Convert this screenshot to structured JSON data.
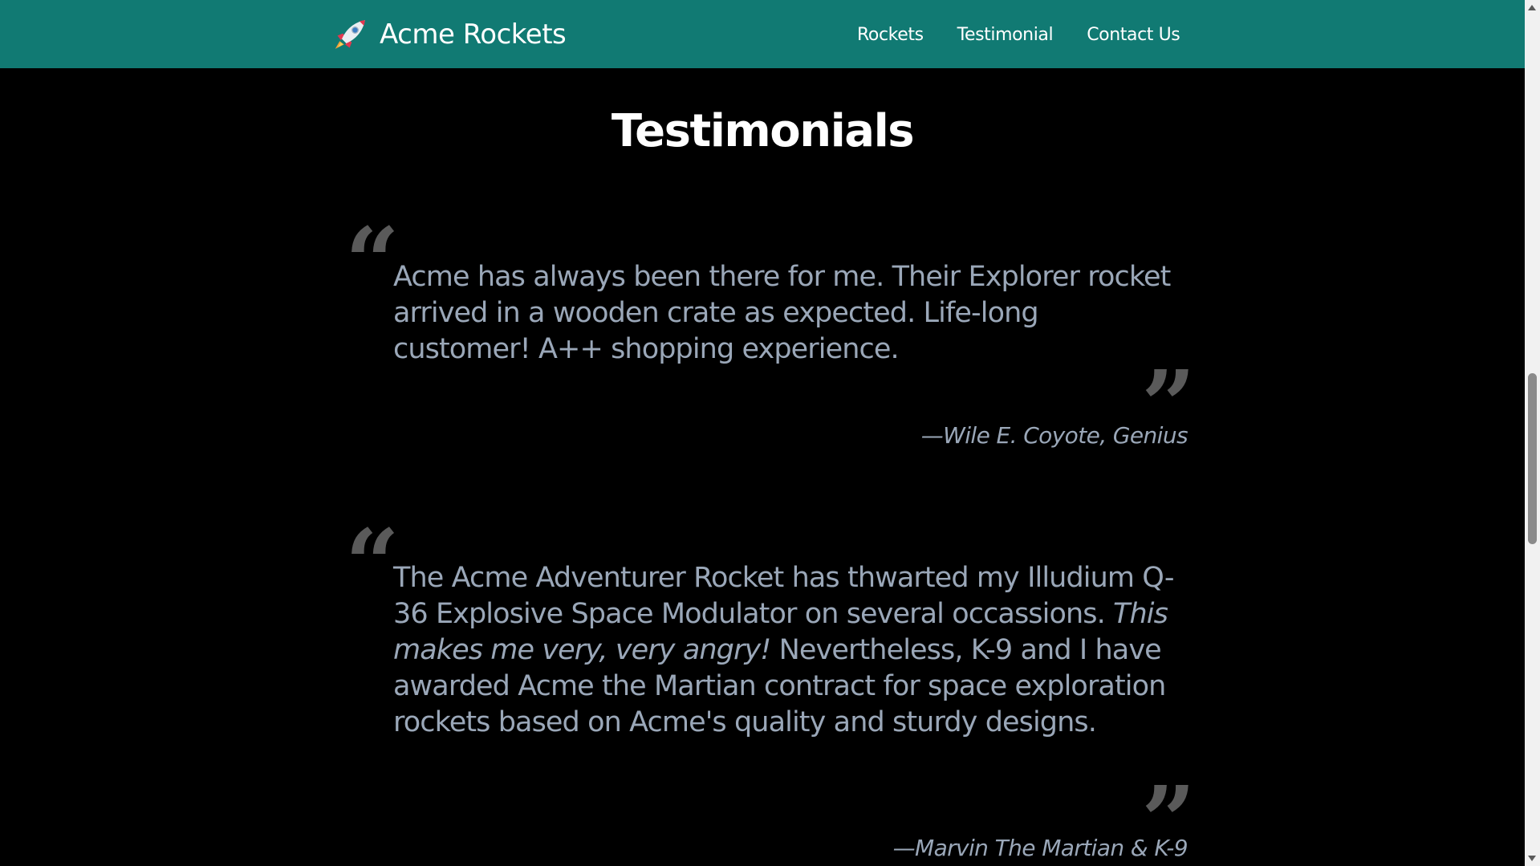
{
  "header": {
    "brand_name": "Acme Rockets",
    "logo_icon": "rocket-icon",
    "background_color": "#117a73",
    "nav": [
      {
        "label": "Rockets"
      },
      {
        "label": "Testimonial"
      },
      {
        "label": "Contact Us"
      }
    ]
  },
  "main": {
    "title": "Testimonials",
    "testimonials": [
      {
        "open_quote": "“",
        "close_quote": "”",
        "text": "Acme has always been there for me. Their Explorer rocket arrived in a wooden crate as expected. Life-long customer! A++ shopping experience.",
        "attribution": "—Wile E. Coyote, Genius"
      },
      {
        "open_quote": "“",
        "close_quote": "”",
        "text_part1": "The Acme Adventurer Rocket has thwarted my Illudium Q-36 Explosive Space Modulator on several occassions. ",
        "text_emphasis": "This makes me very, very angry!",
        "text_part2": " Nevertheless, K-9 and I have awarded Acme the Martian contract for space exploration rockets based on Acme's quality and sturdy designs.",
        "attribution": "—Marvin The Martian & K-9"
      }
    ]
  },
  "colors": {
    "page_background": "#000000",
    "quote_text": "#9aa7b8",
    "quote_marks": "#5a5a5a",
    "heading": "#ffffff"
  }
}
